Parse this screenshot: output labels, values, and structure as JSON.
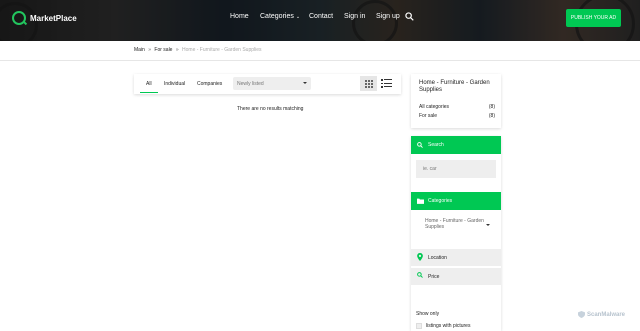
{
  "header": {
    "logo_text": "MarketPlace",
    "nav": [
      "Home",
      "Categories",
      "Contact",
      "Sign in",
      "Sign up"
    ],
    "publish_label": "PUBLISH YOUR AD",
    "accent": "#00c853"
  },
  "breadcrumb": {
    "items": [
      "Main",
      "For sale"
    ],
    "separator": "»",
    "current": "Home - Furniture - Garden Supplies"
  },
  "filters": {
    "tabs": [
      "All",
      "Individual",
      "Companies"
    ],
    "active_tab": "All",
    "sort_selected": "Newly listed"
  },
  "results": {
    "empty_message": "There are no results matching"
  },
  "sidebar": {
    "category_title": "Home - Furniture - Garden Supplies",
    "counts": [
      {
        "label": "All categories",
        "count": "(8)"
      },
      {
        "label": "For sale",
        "count": "(8)"
      }
    ],
    "search_header": "Search",
    "search_placeholder": "ie. car",
    "categories_header": "Categories",
    "category_selected": "Home - Furniture - Garden Supplies",
    "location_label": "Location",
    "price_label": "Price",
    "show_only_label": "Show only",
    "pictures_label": "listings with pictures"
  },
  "watermark": "ScanMalware"
}
